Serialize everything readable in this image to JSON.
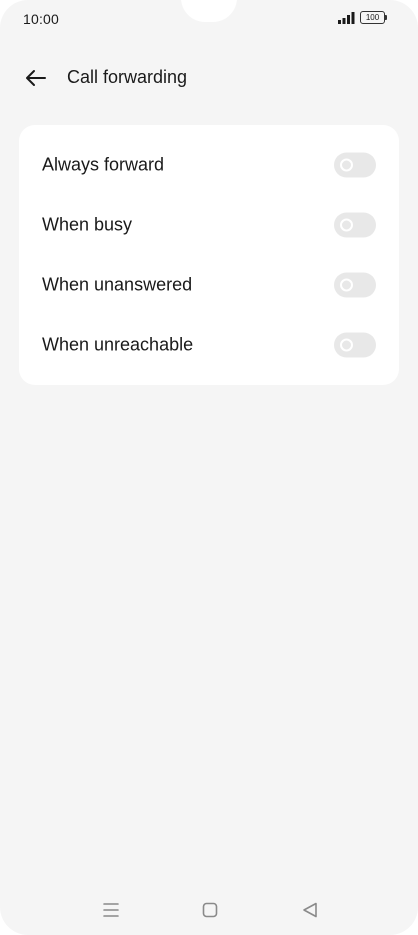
{
  "status_bar": {
    "time": "10:00",
    "battery": "100",
    "icons": [
      "signal-icon",
      "battery-icon"
    ]
  },
  "header": {
    "title": "Call forwarding",
    "back_icon": "arrow-left-icon"
  },
  "forwarding_options": [
    {
      "label": "Always forward",
      "enabled": false
    },
    {
      "label": "When busy",
      "enabled": false
    },
    {
      "label": "When unanswered",
      "enabled": false
    },
    {
      "label": "When unreachable",
      "enabled": false
    }
  ],
  "nav_bar": {
    "icons": [
      "menu-icon",
      "home-icon",
      "back-triangle-icon"
    ]
  },
  "colors": {
    "background": "#f5f5f5",
    "card": "#ffffff",
    "text": "#1a1a1a",
    "toggle_off": "#e8e8e8",
    "nav_icon": "#8a8a8a"
  }
}
